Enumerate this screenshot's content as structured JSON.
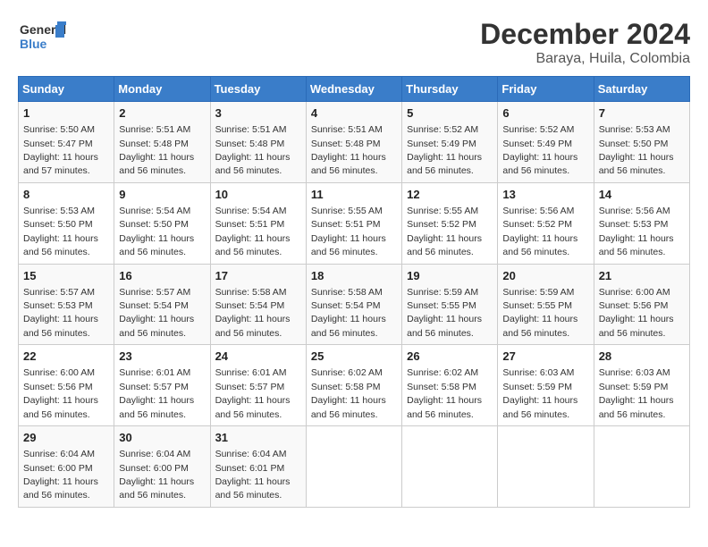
{
  "header": {
    "logo_text_general": "General",
    "logo_text_blue": "Blue",
    "title": "December 2024",
    "subtitle": "Baraya, Huila, Colombia"
  },
  "calendar": {
    "days_of_week": [
      "Sunday",
      "Monday",
      "Tuesday",
      "Wednesday",
      "Thursday",
      "Friday",
      "Saturday"
    ],
    "weeks": [
      [
        {
          "day": 1,
          "sunrise": "5:50 AM",
          "sunset": "5:47 PM",
          "daylight": "11 hours and 57 minutes."
        },
        {
          "day": 2,
          "sunrise": "5:51 AM",
          "sunset": "5:48 PM",
          "daylight": "11 hours and 56 minutes."
        },
        {
          "day": 3,
          "sunrise": "5:51 AM",
          "sunset": "5:48 PM",
          "daylight": "11 hours and 56 minutes."
        },
        {
          "day": 4,
          "sunrise": "5:51 AM",
          "sunset": "5:48 PM",
          "daylight": "11 hours and 56 minutes."
        },
        {
          "day": 5,
          "sunrise": "5:52 AM",
          "sunset": "5:49 PM",
          "daylight": "11 hours and 56 minutes."
        },
        {
          "day": 6,
          "sunrise": "5:52 AM",
          "sunset": "5:49 PM",
          "daylight": "11 hours and 56 minutes."
        },
        {
          "day": 7,
          "sunrise": "5:53 AM",
          "sunset": "5:50 PM",
          "daylight": "11 hours and 56 minutes."
        }
      ],
      [
        {
          "day": 8,
          "sunrise": "5:53 AM",
          "sunset": "5:50 PM",
          "daylight": "11 hours and 56 minutes."
        },
        {
          "day": 9,
          "sunrise": "5:54 AM",
          "sunset": "5:50 PM",
          "daylight": "11 hours and 56 minutes."
        },
        {
          "day": 10,
          "sunrise": "5:54 AM",
          "sunset": "5:51 PM",
          "daylight": "11 hours and 56 minutes."
        },
        {
          "day": 11,
          "sunrise": "5:55 AM",
          "sunset": "5:51 PM",
          "daylight": "11 hours and 56 minutes."
        },
        {
          "day": 12,
          "sunrise": "5:55 AM",
          "sunset": "5:52 PM",
          "daylight": "11 hours and 56 minutes."
        },
        {
          "day": 13,
          "sunrise": "5:56 AM",
          "sunset": "5:52 PM",
          "daylight": "11 hours and 56 minutes."
        },
        {
          "day": 14,
          "sunrise": "5:56 AM",
          "sunset": "5:53 PM",
          "daylight": "11 hours and 56 minutes."
        }
      ],
      [
        {
          "day": 15,
          "sunrise": "5:57 AM",
          "sunset": "5:53 PM",
          "daylight": "11 hours and 56 minutes."
        },
        {
          "day": 16,
          "sunrise": "5:57 AM",
          "sunset": "5:54 PM",
          "daylight": "11 hours and 56 minutes."
        },
        {
          "day": 17,
          "sunrise": "5:58 AM",
          "sunset": "5:54 PM",
          "daylight": "11 hours and 56 minutes."
        },
        {
          "day": 18,
          "sunrise": "5:58 AM",
          "sunset": "5:54 PM",
          "daylight": "11 hours and 56 minutes."
        },
        {
          "day": 19,
          "sunrise": "5:59 AM",
          "sunset": "5:55 PM",
          "daylight": "11 hours and 56 minutes."
        },
        {
          "day": 20,
          "sunrise": "5:59 AM",
          "sunset": "5:55 PM",
          "daylight": "11 hours and 56 minutes."
        },
        {
          "day": 21,
          "sunrise": "6:00 AM",
          "sunset": "5:56 PM",
          "daylight": "11 hours and 56 minutes."
        }
      ],
      [
        {
          "day": 22,
          "sunrise": "6:00 AM",
          "sunset": "5:56 PM",
          "daylight": "11 hours and 56 minutes."
        },
        {
          "day": 23,
          "sunrise": "6:01 AM",
          "sunset": "5:57 PM",
          "daylight": "11 hours and 56 minutes."
        },
        {
          "day": 24,
          "sunrise": "6:01 AM",
          "sunset": "5:57 PM",
          "daylight": "11 hours and 56 minutes."
        },
        {
          "day": 25,
          "sunrise": "6:02 AM",
          "sunset": "5:58 PM",
          "daylight": "11 hours and 56 minutes."
        },
        {
          "day": 26,
          "sunrise": "6:02 AM",
          "sunset": "5:58 PM",
          "daylight": "11 hours and 56 minutes."
        },
        {
          "day": 27,
          "sunrise": "6:03 AM",
          "sunset": "5:59 PM",
          "daylight": "11 hours and 56 minutes."
        },
        {
          "day": 28,
          "sunrise": "6:03 AM",
          "sunset": "5:59 PM",
          "daylight": "11 hours and 56 minutes."
        }
      ],
      [
        {
          "day": 29,
          "sunrise": "6:04 AM",
          "sunset": "6:00 PM",
          "daylight": "11 hours and 56 minutes."
        },
        {
          "day": 30,
          "sunrise": "6:04 AM",
          "sunset": "6:00 PM",
          "daylight": "11 hours and 56 minutes."
        },
        {
          "day": 31,
          "sunrise": "6:04 AM",
          "sunset": "6:01 PM",
          "daylight": "11 hours and 56 minutes."
        },
        null,
        null,
        null,
        null
      ]
    ]
  }
}
